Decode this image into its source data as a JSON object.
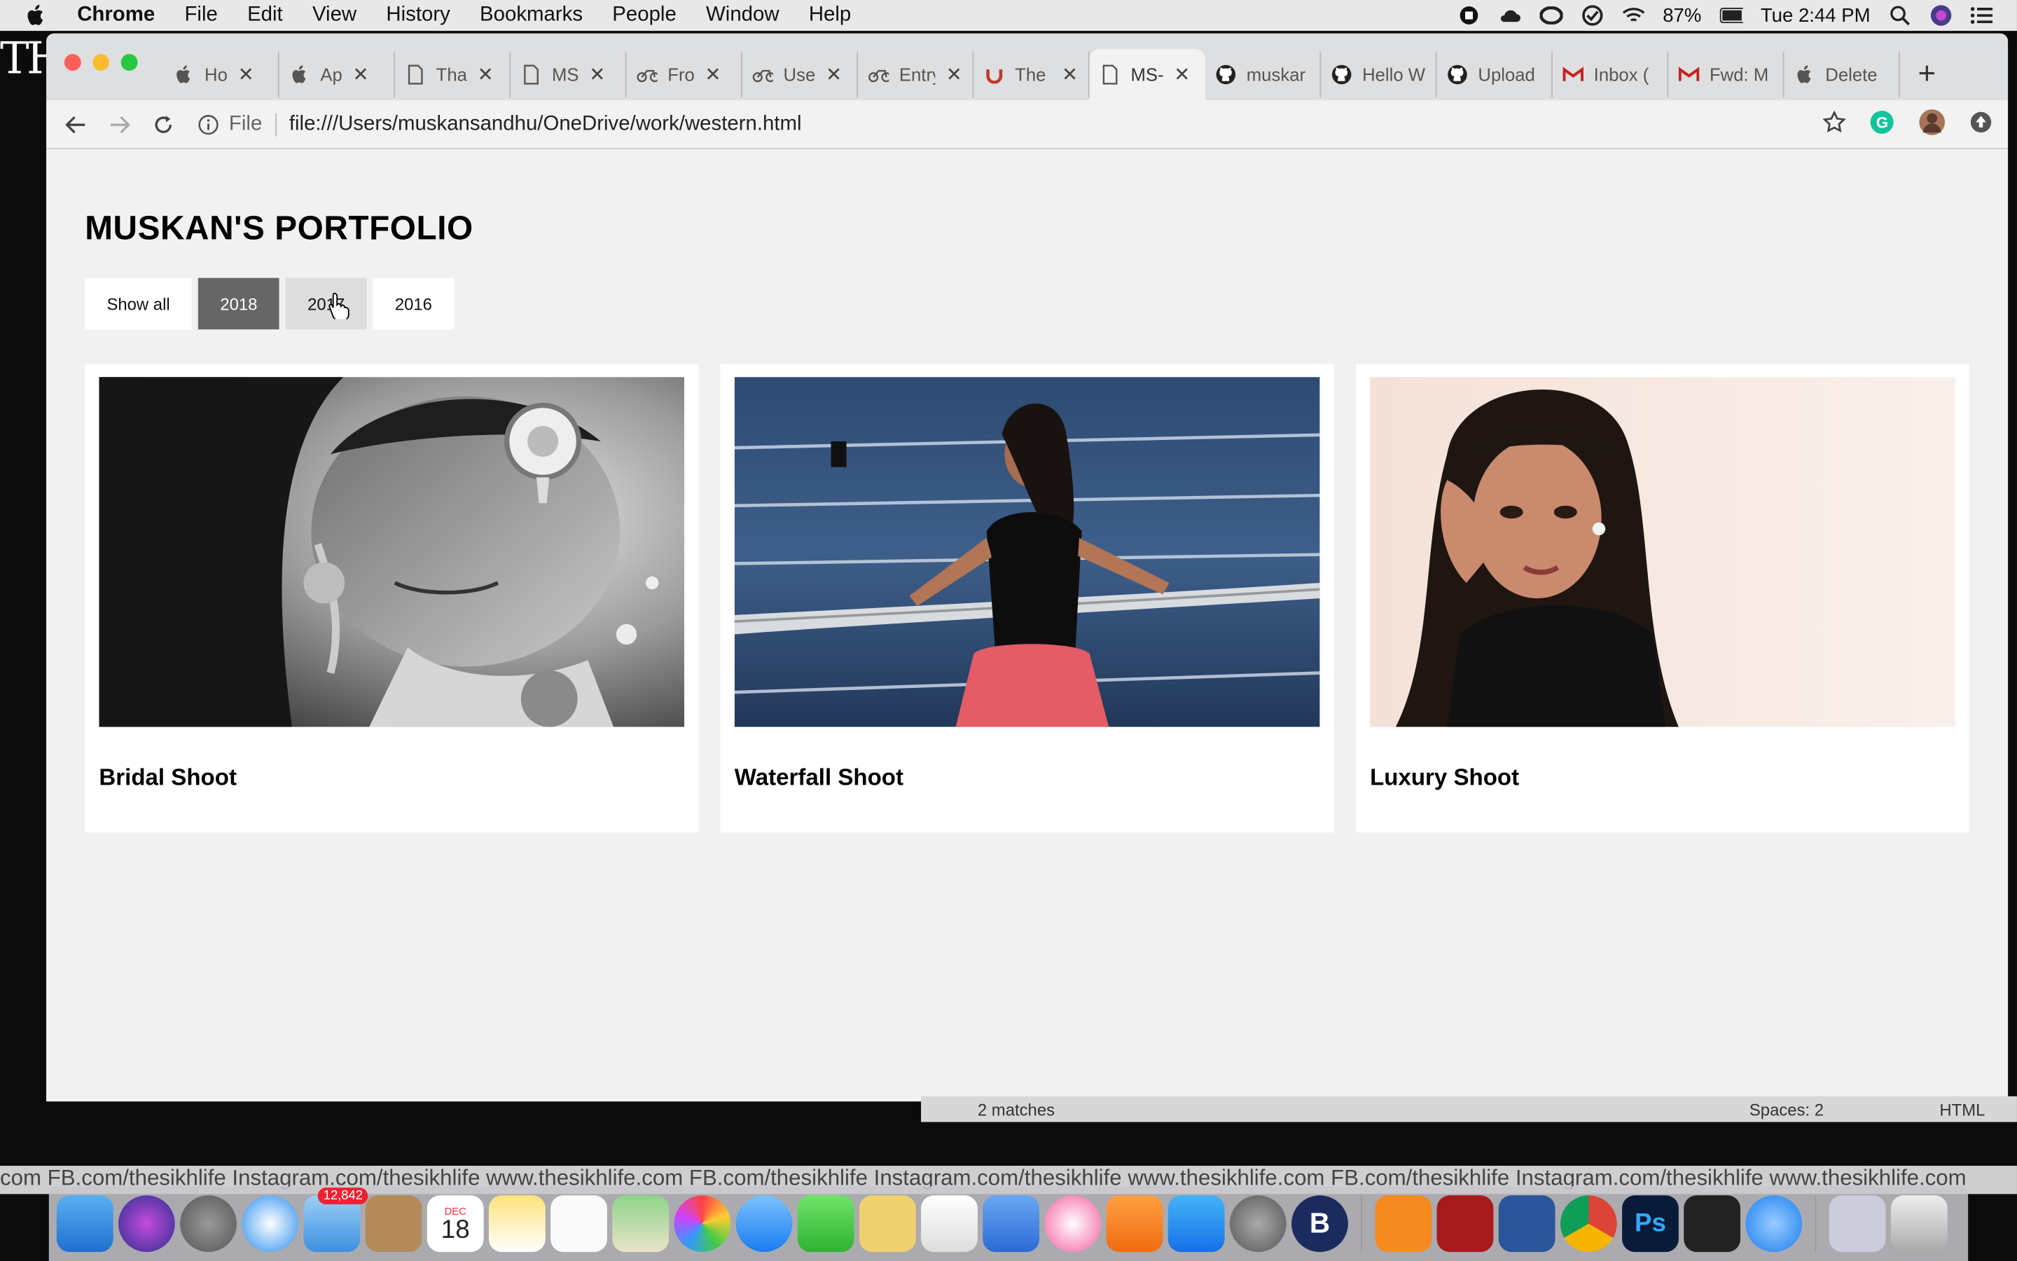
{
  "menubar": {
    "app_name": "Chrome",
    "items": [
      "File",
      "Edit",
      "View",
      "History",
      "Bookmarks",
      "People",
      "Window",
      "Help"
    ],
    "battery": "87%",
    "clock": "Tue 2:44 PM"
  },
  "background": {
    "left_text": "TH",
    "editor_matches": "2 matches",
    "editor_spaces": "Spaces: 2",
    "editor_syntax": "HTML",
    "marquee": "com  FB.com/thesikhlife  Instagram.com/thesikhlife  www.thesikhlife.com  FB.com/thesikhlife  Instagram.com/thesikhlife  www.thesikhlife.com  FB.com/thesikhlife  Instagram.com/thesikhlife  www.thesikhlife.com"
  },
  "tabs": [
    {
      "title": "Ho",
      "icon": "apple-icon"
    },
    {
      "title": "Ap",
      "icon": "apple-icon"
    },
    {
      "title": "Tha",
      "icon": "file-icon"
    },
    {
      "title": "MS",
      "icon": "file-icon"
    },
    {
      "title": "Fro",
      "icon": "bike-icon"
    },
    {
      "title": "Use",
      "icon": "bike-icon"
    },
    {
      "title": "Entry-L",
      "icon": "bike-icon"
    },
    {
      "title": "The Co",
      "icon": "udemy-icon"
    },
    {
      "title": "MS-",
      "icon": "file-icon",
      "active": true
    },
    {
      "title": "muskar",
      "icon": "github-icon"
    },
    {
      "title": "Hello W",
      "icon": "github-icon"
    },
    {
      "title": "Upload",
      "icon": "github-icon"
    },
    {
      "title": "Inbox (",
      "icon": "gmail-icon"
    },
    {
      "title": "Fwd: M",
      "icon": "gmail-icon"
    },
    {
      "title": "Delete",
      "icon": "apple-icon"
    }
  ],
  "omnibox": {
    "scheme_label": "File",
    "url": "file:///Users/muskansandhu/OneDrive/work/western.html"
  },
  "page": {
    "title": "MUSKAN'S PORTFOLIO",
    "filters": [
      {
        "label": "Show all",
        "state": "normal"
      },
      {
        "label": "2018",
        "state": "active"
      },
      {
        "label": "2017",
        "state": "hover"
      },
      {
        "label": "2016",
        "state": "normal"
      }
    ],
    "cards": [
      {
        "caption": "Bridal Shoot",
        "photo": "bw-bride-photo"
      },
      {
        "caption": "Waterfall Shoot",
        "photo": "woman-waterfront-photo"
      },
      {
        "caption": "Luxury Shoot",
        "photo": "woman-portrait-photo"
      }
    ]
  },
  "dock": {
    "mail_badge": "12,842",
    "calendar_month": "DEC",
    "calendar_day": "18"
  },
  "colors": {
    "active_filter": "#666666",
    "hover_filter": "#dddddd",
    "page_bg": "#f1f1f1"
  }
}
